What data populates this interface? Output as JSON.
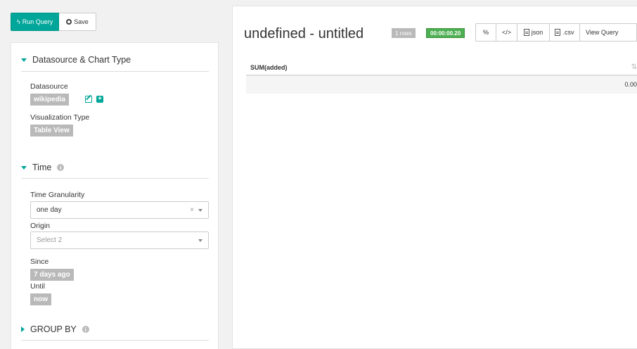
{
  "actions": {
    "run_query": "Run Query",
    "save": "Save"
  },
  "sidebar": {
    "sections": {
      "datasource": {
        "title": "Datasource & Chart Type",
        "datasource_label": "Datasource",
        "datasource_value": "wikipedia",
        "viz_label": "Visualization Type",
        "viz_value": "Table View"
      },
      "time": {
        "title": "Time",
        "granularity_label": "Time Granularity",
        "granularity_value": "one day",
        "origin_label": "Origin",
        "origin_placeholder": "Select 2",
        "since_label": "Since",
        "since_value": "7 days ago",
        "until_label": "Until",
        "until_value": "now"
      },
      "groupby": {
        "title": "GROUP BY"
      }
    }
  },
  "main": {
    "title": "undefined - untitled",
    "rows_badge": "1 rows",
    "time_badge": "00:00:00.20",
    "toolbar": {
      "link_glyph": "%",
      "embed_glyph": "</>",
      "json_label": "json",
      "csv_label": ".csv",
      "view_query_label": "View Query"
    },
    "table": {
      "columns": [
        "SUM(added)"
      ],
      "rows": [
        [
          "0.00"
        ]
      ]
    }
  },
  "colors": {
    "accent": "#00a699",
    "success": "#4caf50",
    "tag_gray": "#b9b9b9"
  },
  "icons": [
    "bolt-icon",
    "save-icon",
    "caret-down-icon",
    "caret-right-icon",
    "info-icon",
    "edit-icon",
    "plus-icon",
    "link-icon",
    "embed-icon",
    "json-file-icon",
    "csv-file-icon",
    "sort-icon"
  ]
}
